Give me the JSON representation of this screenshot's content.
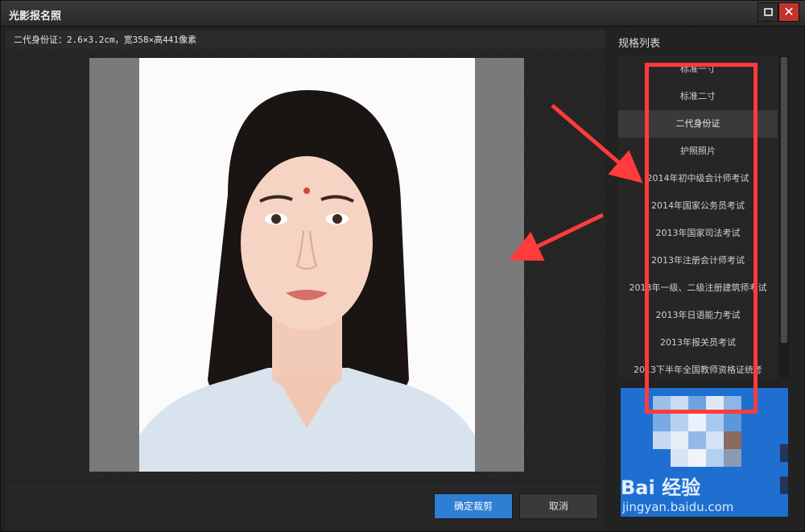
{
  "window": {
    "title": "光影报名照",
    "maximize_label": "maximize",
    "close_label": "close"
  },
  "info_bar": {
    "text": "二代身份证：2.6×3.2cm，宽358×高441像素"
  },
  "spec_panel": {
    "title": "规格列表",
    "items": [
      {
        "label": "标准一寸"
      },
      {
        "label": "标准二寸"
      },
      {
        "label": "二代身份证",
        "selected": true
      },
      {
        "label": "护照照片"
      },
      {
        "label": "2014年初中级会计师考试"
      },
      {
        "label": "2014年国家公务员考试"
      },
      {
        "label": "2013年国家司法考试"
      },
      {
        "label": "2013年注册会计师考试"
      },
      {
        "label": "2013年一级、二级注册建筑师考试"
      },
      {
        "label": "2013年日语能力考试"
      },
      {
        "label": "2013年报关员考试"
      },
      {
        "label": "2013下半年全国教师资格证统考"
      }
    ]
  },
  "buttons": {
    "confirm_crop": "确定裁剪",
    "cancel": "取消"
  },
  "watermark": {
    "brand": "Bai 经验",
    "url": "jingyan.baidu.com"
  },
  "colors": {
    "accent": "#2e7ed3",
    "close_button": "#c4332b",
    "annotation": "#ff3b3b",
    "preview_bg": "#1e6fd0"
  }
}
